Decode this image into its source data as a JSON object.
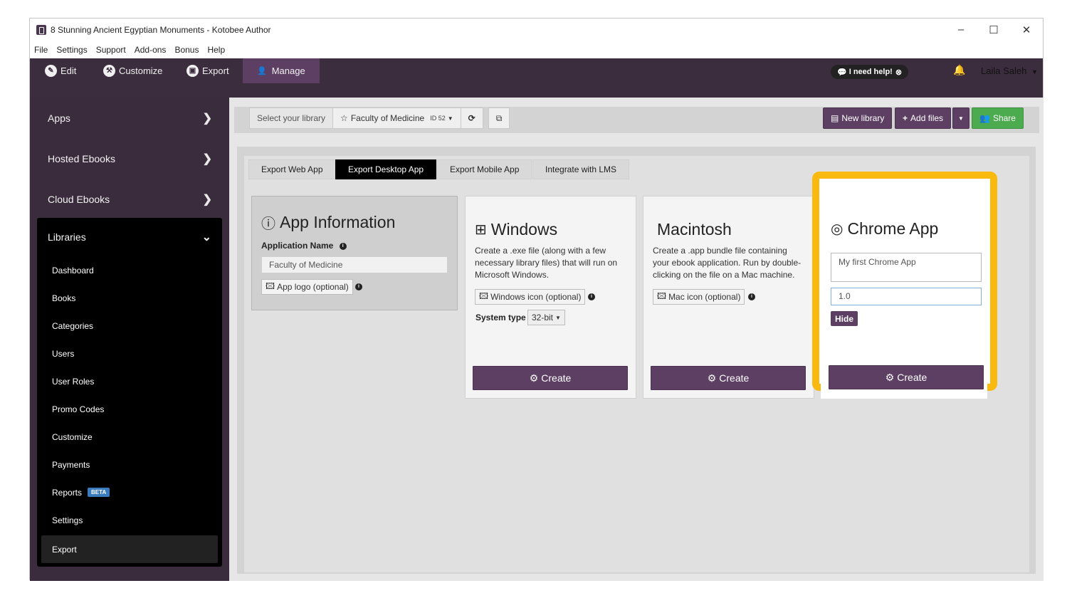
{
  "window": {
    "title": "8 Stunning Ancient Egyptian Monuments - Kotobee Author",
    "controls": [
      "–",
      "☐",
      "✕"
    ]
  },
  "menubar": [
    "File",
    "Settings",
    "Support",
    "Add-ons",
    "Bonus",
    "Help"
  ],
  "top_tabs": [
    {
      "label": "Edit",
      "icon": "pencil-icon"
    },
    {
      "label": "Customize",
      "icon": "wrench-icon"
    },
    {
      "label": "Export",
      "icon": "export-icon"
    },
    {
      "label": "Manage",
      "icon": "user-icon",
      "active": true
    }
  ],
  "header": {
    "help_label": "I need help!",
    "user_name": "Laila Saleh"
  },
  "sidebar": {
    "top_items": [
      "Apps",
      "Hosted Ebooks",
      "Cloud Ebooks"
    ],
    "libraries_label": "Libraries",
    "library_items": [
      "Dashboard",
      "Books",
      "Categories",
      "Users",
      "User Roles",
      "Promo Codes",
      "Customize",
      "Payments",
      "Reports",
      "Settings",
      "Export"
    ],
    "reports_badge": "BETA",
    "active_item": "Export"
  },
  "toolbar": {
    "select_label": "Select your library",
    "library_name": "Faculty of Medicine",
    "library_id": "ID 52",
    "new_library": "New library",
    "add_files": "Add files",
    "share": "Share"
  },
  "sub_tabs": [
    {
      "label": "Export Web App"
    },
    {
      "label": "Export Desktop App",
      "active": true
    },
    {
      "label": "Export Mobile App"
    },
    {
      "label": "Integrate with LMS"
    }
  ],
  "app_info": {
    "title": "App Information",
    "app_name_label": "Application Name",
    "app_name_value": "Faculty of Medicine",
    "logo_button": "App logo (optional)"
  },
  "windows": {
    "title": "Windows",
    "description": "Create a .exe file (along with a few necessary library files) that will run on Microsoft Windows.",
    "icon_button": "Windows icon (optional)",
    "system_type_label": "System type",
    "system_type_value": "32-bit",
    "create": "Create"
  },
  "mac": {
    "title": "Macintosh",
    "description": "Create a .app bundle file containing your ebook application. Run by double-clicking on the file on a Mac machine.",
    "icon_button": "Mac icon (optional)",
    "create": "Create"
  },
  "chrome": {
    "title": "Chrome App",
    "name_placeholder": "My first Chrome App",
    "version_value": "1.0",
    "hide_label": "Hide",
    "create": "Create"
  },
  "colors": {
    "accent_purple": "#5c3f63",
    "dark_nav": "#3c2d3e",
    "highlight": "#f9b90f",
    "share_green": "#4caa4f",
    "beta_blue": "#3a7bbf"
  }
}
